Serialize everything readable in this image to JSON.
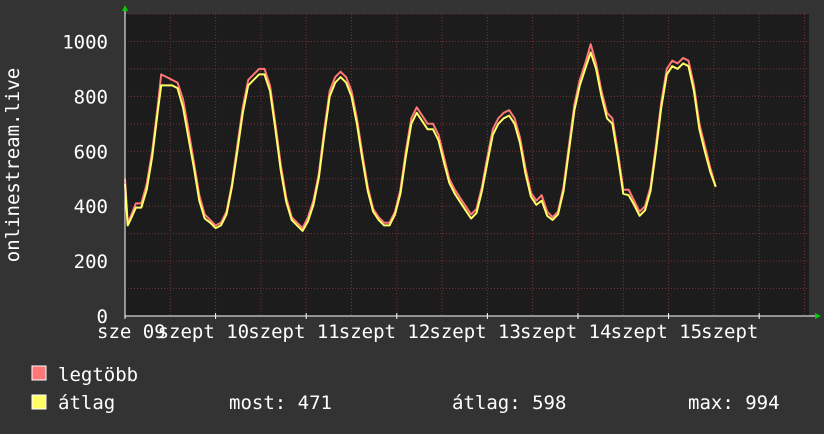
{
  "chart_data": {
    "type": "line",
    "ylabel": "onlinestream.live",
    "ylim": [
      0,
      1100
    ],
    "yticks": [
      0,
      200,
      400,
      600,
      800,
      1000
    ],
    "xlim": [
      0,
      7.55
    ],
    "xticks": [
      {
        "x": 0.0,
        "label": "sze 09"
      },
      {
        "x": 1.0,
        "label": "szept 10"
      },
      {
        "x": 2.0,
        "label": "szept 11"
      },
      {
        "x": 3.0,
        "label": "szept 12"
      },
      {
        "x": 4.0,
        "label": "szept 13"
      },
      {
        "x": 5.0,
        "label": "szept 14"
      },
      {
        "x": 6.0,
        "label": "szept 15"
      },
      {
        "x": 7.0,
        "label": "szept"
      }
    ],
    "grid": true,
    "series": [
      {
        "name": "legtöbb",
        "color": "#ff7777",
        "points": [
          [
            0.0,
            500
          ],
          [
            0.03,
            340
          ],
          [
            0.06,
            360
          ],
          [
            0.12,
            410
          ],
          [
            0.18,
            410
          ],
          [
            0.24,
            480
          ],
          [
            0.3,
            600
          ],
          [
            0.36,
            760
          ],
          [
            0.4,
            880
          ],
          [
            0.46,
            870
          ],
          [
            0.52,
            860
          ],
          [
            0.58,
            850
          ],
          [
            0.64,
            790
          ],
          [
            0.7,
            680
          ],
          [
            0.76,
            560
          ],
          [
            0.82,
            440
          ],
          [
            0.88,
            370
          ],
          [
            0.94,
            350
          ],
          [
            1.0,
            330
          ],
          [
            1.06,
            340
          ],
          [
            1.12,
            380
          ],
          [
            1.18,
            480
          ],
          [
            1.24,
            620
          ],
          [
            1.3,
            760
          ],
          [
            1.36,
            860
          ],
          [
            1.42,
            880
          ],
          [
            1.48,
            900
          ],
          [
            1.54,
            900
          ],
          [
            1.6,
            840
          ],
          [
            1.66,
            700
          ],
          [
            1.72,
            550
          ],
          [
            1.78,
            430
          ],
          [
            1.84,
            360
          ],
          [
            1.9,
            340
          ],
          [
            1.96,
            320
          ],
          [
            2.02,
            360
          ],
          [
            2.08,
            420
          ],
          [
            2.14,
            520
          ],
          [
            2.2,
            680
          ],
          [
            2.26,
            820
          ],
          [
            2.32,
            870
          ],
          [
            2.38,
            890
          ],
          [
            2.44,
            870
          ],
          [
            2.5,
            820
          ],
          [
            2.56,
            720
          ],
          [
            2.62,
            590
          ],
          [
            2.68,
            470
          ],
          [
            2.74,
            390
          ],
          [
            2.8,
            360
          ],
          [
            2.86,
            340
          ],
          [
            2.92,
            340
          ],
          [
            2.98,
            380
          ],
          [
            3.04,
            460
          ],
          [
            3.1,
            600
          ],
          [
            3.16,
            720
          ],
          [
            3.22,
            760
          ],
          [
            3.28,
            730
          ],
          [
            3.34,
            700
          ],
          [
            3.4,
            700
          ],
          [
            3.46,
            660
          ],
          [
            3.52,
            580
          ],
          [
            3.58,
            500
          ],
          [
            3.64,
            460
          ],
          [
            3.7,
            430
          ],
          [
            3.76,
            400
          ],
          [
            3.82,
            370
          ],
          [
            3.88,
            390
          ],
          [
            3.94,
            470
          ],
          [
            4.0,
            580
          ],
          [
            4.06,
            680
          ],
          [
            4.12,
            720
          ],
          [
            4.18,
            740
          ],
          [
            4.24,
            750
          ],
          [
            4.3,
            720
          ],
          [
            4.36,
            650
          ],
          [
            4.42,
            540
          ],
          [
            4.48,
            450
          ],
          [
            4.54,
            420
          ],
          [
            4.6,
            440
          ],
          [
            4.66,
            380
          ],
          [
            4.72,
            360
          ],
          [
            4.78,
            380
          ],
          [
            4.84,
            470
          ],
          [
            4.9,
            620
          ],
          [
            4.96,
            770
          ],
          [
            5.02,
            860
          ],
          [
            5.08,
            920
          ],
          [
            5.14,
            990
          ],
          [
            5.2,
            920
          ],
          [
            5.26,
            820
          ],
          [
            5.32,
            740
          ],
          [
            5.38,
            720
          ],
          [
            5.44,
            600
          ],
          [
            5.5,
            460
          ],
          [
            5.56,
            460
          ],
          [
            5.62,
            420
          ],
          [
            5.68,
            380
          ],
          [
            5.74,
            400
          ],
          [
            5.8,
            470
          ],
          [
            5.86,
            620
          ],
          [
            5.92,
            780
          ],
          [
            5.98,
            900
          ],
          [
            6.04,
            930
          ],
          [
            6.1,
            920
          ],
          [
            6.16,
            940
          ],
          [
            6.22,
            930
          ],
          [
            6.28,
            840
          ],
          [
            6.34,
            700
          ],
          [
            6.4,
            620
          ],
          [
            6.46,
            540
          ],
          [
            6.52,
            470
          ]
        ]
      },
      {
        "name": "átlag",
        "color": "#ffff66",
        "points": [
          [
            0.0,
            480
          ],
          [
            0.03,
            330
          ],
          [
            0.06,
            350
          ],
          [
            0.12,
            395
          ],
          [
            0.18,
            395
          ],
          [
            0.24,
            460
          ],
          [
            0.3,
            580
          ],
          [
            0.36,
            740
          ],
          [
            0.4,
            840
          ],
          [
            0.46,
            840
          ],
          [
            0.52,
            840
          ],
          [
            0.58,
            830
          ],
          [
            0.64,
            760
          ],
          [
            0.7,
            650
          ],
          [
            0.76,
            540
          ],
          [
            0.82,
            420
          ],
          [
            0.88,
            355
          ],
          [
            0.94,
            340
          ],
          [
            1.0,
            320
          ],
          [
            1.06,
            330
          ],
          [
            1.12,
            370
          ],
          [
            1.18,
            470
          ],
          [
            1.24,
            600
          ],
          [
            1.3,
            740
          ],
          [
            1.36,
            840
          ],
          [
            1.42,
            860
          ],
          [
            1.48,
            880
          ],
          [
            1.54,
            880
          ],
          [
            1.6,
            820
          ],
          [
            1.66,
            680
          ],
          [
            1.72,
            530
          ],
          [
            1.78,
            415
          ],
          [
            1.84,
            350
          ],
          [
            1.9,
            330
          ],
          [
            1.96,
            310
          ],
          [
            2.02,
            345
          ],
          [
            2.08,
            405
          ],
          [
            2.14,
            505
          ],
          [
            2.2,
            660
          ],
          [
            2.26,
            800
          ],
          [
            2.32,
            850
          ],
          [
            2.38,
            870
          ],
          [
            2.44,
            850
          ],
          [
            2.5,
            800
          ],
          [
            2.56,
            700
          ],
          [
            2.62,
            570
          ],
          [
            2.68,
            455
          ],
          [
            2.74,
            380
          ],
          [
            2.8,
            350
          ],
          [
            2.86,
            330
          ],
          [
            2.92,
            330
          ],
          [
            2.98,
            370
          ],
          [
            3.04,
            445
          ],
          [
            3.1,
            580
          ],
          [
            3.16,
            700
          ],
          [
            3.22,
            740
          ],
          [
            3.28,
            710
          ],
          [
            3.34,
            680
          ],
          [
            3.4,
            680
          ],
          [
            3.46,
            640
          ],
          [
            3.52,
            560
          ],
          [
            3.58,
            485
          ],
          [
            3.64,
            445
          ],
          [
            3.7,
            415
          ],
          [
            3.76,
            385
          ],
          [
            3.82,
            355
          ],
          [
            3.88,
            375
          ],
          [
            3.94,
            455
          ],
          [
            4.0,
            560
          ],
          [
            4.06,
            660
          ],
          [
            4.12,
            700
          ],
          [
            4.18,
            720
          ],
          [
            4.24,
            730
          ],
          [
            4.3,
            700
          ],
          [
            4.36,
            630
          ],
          [
            4.42,
            520
          ],
          [
            4.48,
            435
          ],
          [
            4.54,
            405
          ],
          [
            4.6,
            420
          ],
          [
            4.66,
            365
          ],
          [
            4.72,
            350
          ],
          [
            4.78,
            370
          ],
          [
            4.84,
            455
          ],
          [
            4.9,
            600
          ],
          [
            4.96,
            750
          ],
          [
            5.02,
            840
          ],
          [
            5.08,
            900
          ],
          [
            5.14,
            960
          ],
          [
            5.2,
            900
          ],
          [
            5.26,
            800
          ],
          [
            5.32,
            720
          ],
          [
            5.38,
            700
          ],
          [
            5.44,
            580
          ],
          [
            5.5,
            445
          ],
          [
            5.56,
            440
          ],
          [
            5.62,
            405
          ],
          [
            5.68,
            365
          ],
          [
            5.74,
            385
          ],
          [
            5.8,
            455
          ],
          [
            5.86,
            600
          ],
          [
            5.92,
            760
          ],
          [
            5.98,
            880
          ],
          [
            6.04,
            910
          ],
          [
            6.1,
            900
          ],
          [
            6.16,
            920
          ],
          [
            6.22,
            910
          ],
          [
            6.28,
            820
          ],
          [
            6.34,
            680
          ],
          [
            6.4,
            600
          ],
          [
            6.46,
            525
          ],
          [
            6.52,
            471
          ]
        ]
      }
    ]
  },
  "legend": {
    "max_label": "legtöbb",
    "avg_label": "átlag",
    "stats": {
      "now": "most: 471",
      "average": "átlag: 598",
      "max": "max: 994"
    }
  },
  "colors": {
    "background": "#333333",
    "plot_area": "#1c1c1c",
    "grid": "#7a3030",
    "axis": "#ffffff",
    "text": "#ffffff",
    "arrow": "#00cc00"
  }
}
